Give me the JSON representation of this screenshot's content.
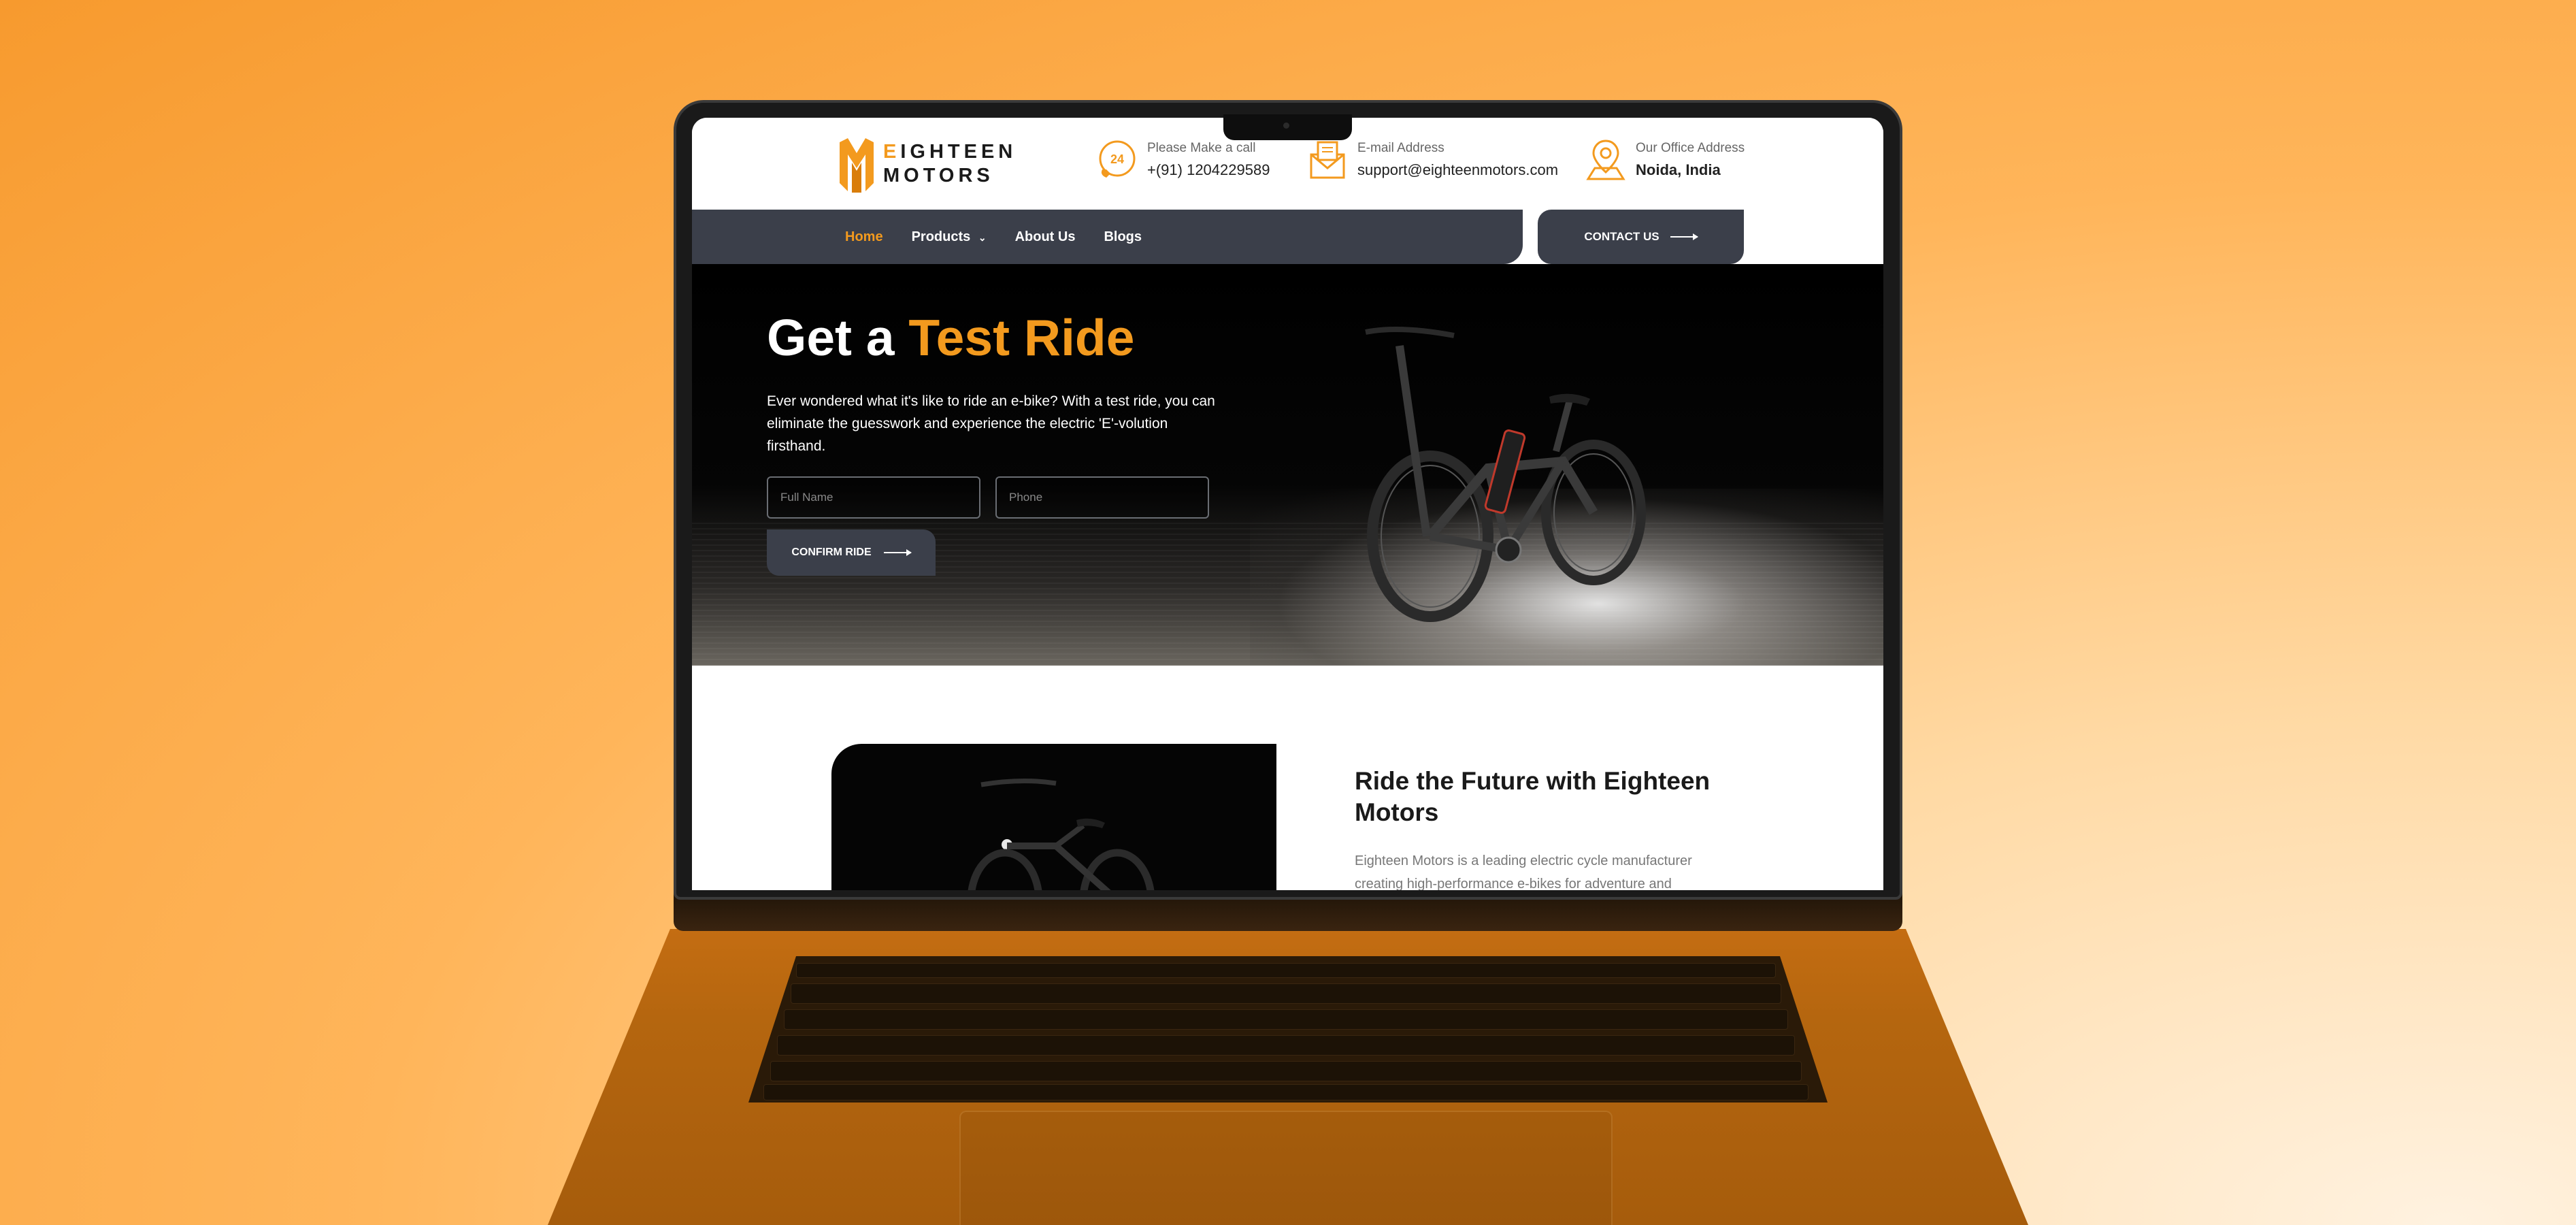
{
  "site": {
    "logo": {
      "line1": "EIGHTEEN",
      "line2": "MOTORS"
    },
    "contacts": [
      {
        "label": "Please Make a call",
        "value": "+(91) 1204229589",
        "icon": "phone-24-icon"
      },
      {
        "label": "E-mail Address",
        "value": "support@eighteenmotors.com",
        "icon": "mail-icon"
      },
      {
        "label": "Our Office Address",
        "value": "Noida, India",
        "icon": "location-pin-icon"
      }
    ],
    "nav": {
      "items": [
        {
          "label": "Home",
          "active": true
        },
        {
          "label": "Products",
          "dropdown": true
        },
        {
          "label": "About Us"
        },
        {
          "label": "Blogs"
        }
      ],
      "contact_button": "CONTACT US"
    },
    "hero": {
      "title_plain": "Get a",
      "title_highlight": "Test Ride",
      "description": "Ever wondered what it's like to ride an e-bike? With a test ride, you can eliminate the guesswork and experience the electric 'E'-volution firsthand.",
      "full_name_placeholder": "Full Name",
      "phone_placeholder": "Phone",
      "confirm_button": "CONFIRM RIDE"
    },
    "about": {
      "title": "Ride the Future with Eighteen Motors",
      "text": "Eighteen Motors is a leading electric cycle manufacturer creating high-performance e-bikes for adventure and"
    }
  },
  "colors": {
    "accent": "#f39a1e",
    "nav_bg": "#3b3f4a",
    "hero_bg": "#000000"
  }
}
